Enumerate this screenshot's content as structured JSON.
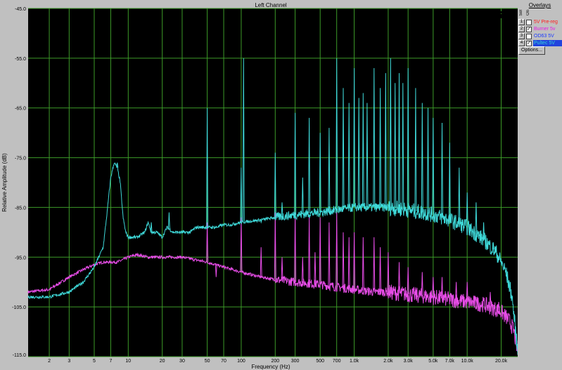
{
  "chart_data": {
    "type": "line",
    "title": "Left Channel",
    "xlabel": "Frequency (Hz)",
    "ylabel": "Relative Amplitude (dB)",
    "xscale": "log",
    "xlim": [
      1.3,
      28000
    ],
    "ylim": [
      -115,
      -45
    ],
    "grid": true,
    "x_ticks": [
      {
        "value": 2,
        "label": "2"
      },
      {
        "value": 3,
        "label": "3"
      },
      {
        "value": 5,
        "label": "5"
      },
      {
        "value": 7,
        "label": "7"
      },
      {
        "value": 10,
        "label": "10"
      },
      {
        "value": 20,
        "label": "20"
      },
      {
        "value": 30,
        "label": "30"
      },
      {
        "value": 50,
        "label": "50"
      },
      {
        "value": 70,
        "label": "70"
      },
      {
        "value": 100,
        "label": "100"
      },
      {
        "value": 200,
        "label": "200"
      },
      {
        "value": 300,
        "label": "300"
      },
      {
        "value": 500,
        "label": "500"
      },
      {
        "value": 700,
        "label": "700"
      },
      {
        "value": 1000,
        "label": "1.0k"
      },
      {
        "value": 2000,
        "label": "2.0k"
      },
      {
        "value": 3000,
        "label": "3.0k"
      },
      {
        "value": 5000,
        "label": "5.0k"
      },
      {
        "value": 7000,
        "label": "7.0k"
      },
      {
        "value": 10000,
        "label": "10.0k"
      },
      {
        "value": 20000,
        "label": "20.0k"
      }
    ],
    "y_ticks": [
      -45,
      -55,
      -65,
      -75,
      -85,
      -95,
      -105,
      -115
    ],
    "y_tick_labels": [
      "-45.0",
      "-55.0",
      "-65.0",
      "-75.0",
      "-85.0",
      "-95.0",
      "-105.0",
      "-115.0"
    ],
    "series": [
      {
        "name": "Pultec 5V",
        "color": "#3ed8d8",
        "x": [
          1.3,
          2,
          3,
          4,
          5,
          6,
          6.5,
          7,
          7.5,
          8,
          8.5,
          9,
          9.5,
          10,
          12,
          14,
          15,
          16,
          18,
          20,
          22,
          25,
          27,
          30,
          35,
          40,
          50,
          60,
          70,
          80,
          100,
          150,
          200,
          300,
          500,
          700,
          1000,
          1500,
          2000,
          3000,
          4000,
          5000,
          7000,
          10000,
          14000,
          18000,
          20000,
          22000,
          25000,
          28000
        ],
        "y": [
          -103,
          -103,
          -102,
          -100,
          -97,
          -93,
          -86,
          -79,
          -76,
          -77,
          -80,
          -87,
          -90,
          -91,
          -91,
          -90,
          -88,
          -90,
          -90,
          -91,
          -89,
          -90,
          -90,
          -90,
          -90,
          -89,
          -89,
          -89,
          -88.5,
          -88.5,
          -88,
          -87.5,
          -87,
          -86.5,
          -86,
          -85.5,
          -85,
          -85,
          -85,
          -85.5,
          -86,
          -86.5,
          -87.5,
          -89,
          -91.5,
          -94,
          -96,
          -98,
          -103,
          -114
        ],
        "peaks": [
          {
            "x": 8,
            "y": -76
          },
          {
            "x": 16,
            "y": -88
          },
          {
            "x": 23,
            "y": -86
          },
          {
            "x": 50,
            "y": -65
          },
          {
            "x": 100,
            "y": -77
          },
          {
            "x": 105,
            "y": -55
          },
          {
            "x": 150,
            "y": -88
          },
          {
            "x": 200,
            "y": -74
          },
          {
            "x": 230,
            "y": -84
          },
          {
            "x": 300,
            "y": -66
          },
          {
            "x": 350,
            "y": -79
          },
          {
            "x": 400,
            "y": -67
          },
          {
            "x": 500,
            "y": -70
          },
          {
            "x": 600,
            "y": -69
          },
          {
            "x": 700,
            "y": -55
          },
          {
            "x": 800,
            "y": -61
          },
          {
            "x": 900,
            "y": -64
          },
          {
            "x": 1000,
            "y": -57
          },
          {
            "x": 1100,
            "y": -63
          },
          {
            "x": 1200,
            "y": -62
          },
          {
            "x": 1300,
            "y": -64
          },
          {
            "x": 1500,
            "y": -57
          },
          {
            "x": 1700,
            "y": -61
          },
          {
            "x": 1900,
            "y": -58
          },
          {
            "x": 2100,
            "y": -55
          },
          {
            "x": 2300,
            "y": -60
          },
          {
            "x": 2500,
            "y": -58
          },
          {
            "x": 2700,
            "y": -60
          },
          {
            "x": 3000,
            "y": -57
          },
          {
            "x": 3500,
            "y": -61
          },
          {
            "x": 4000,
            "y": -64
          },
          {
            "x": 4500,
            "y": -65
          },
          {
            "x": 5000,
            "y": -67
          },
          {
            "x": 6000,
            "y": -68
          },
          {
            "x": 7000,
            "y": -72
          },
          {
            "x": 8500,
            "y": -77
          },
          {
            "x": 10000,
            "y": -82
          },
          {
            "x": 12000,
            "y": -84
          },
          {
            "x": 14000,
            "y": -88
          },
          {
            "x": 17000,
            "y": -92
          }
        ]
      },
      {
        "name": "Burner 5v",
        "color": "#e64ce6",
        "x": [
          1.3,
          2,
          3,
          4,
          5,
          6,
          7,
          8,
          9,
          10,
          12,
          15,
          20,
          30,
          50,
          70,
          100,
          150,
          200,
          300,
          500,
          700,
          1000,
          1500,
          2000,
          3000,
          5000,
          7000,
          10000,
          14000,
          18000,
          20000,
          22000,
          24000,
          26000,
          28000
        ],
        "y": [
          -102,
          -101.5,
          -99,
          -97.5,
          -96.5,
          -96,
          -96,
          -96,
          -95.5,
          -95,
          -94.5,
          -95,
          -95,
          -95,
          -96,
          -97,
          -98,
          -99,
          -99.5,
          -100,
          -100.5,
          -101,
          -101.5,
          -102,
          -102,
          -102.5,
          -103,
          -103.5,
          -104,
          -104.5,
          -105.5,
          -106,
          -107,
          -108,
          -110,
          -114
        ],
        "peaks": [
          {
            "x": 50,
            "y": -88
          },
          {
            "x": 60,
            "y": -99
          },
          {
            "x": 100,
            "y": -87
          },
          {
            "x": 150,
            "y": -93
          },
          {
            "x": 200,
            "y": -86
          },
          {
            "x": 230,
            "y": -95
          },
          {
            "x": 300,
            "y": -86
          },
          {
            "x": 350,
            "y": -95
          },
          {
            "x": 400,
            "y": -87
          },
          {
            "x": 450,
            "y": -94
          },
          {
            "x": 500,
            "y": -87
          },
          {
            "x": 600,
            "y": -88
          },
          {
            "x": 700,
            "y": -86
          },
          {
            "x": 800,
            "y": -90
          },
          {
            "x": 900,
            "y": -91
          },
          {
            "x": 1000,
            "y": -90
          },
          {
            "x": 1200,
            "y": -91
          },
          {
            "x": 1500,
            "y": -91
          },
          {
            "x": 1700,
            "y": -93
          },
          {
            "x": 2000,
            "y": -94
          },
          {
            "x": 2500,
            "y": -96
          },
          {
            "x": 3000,
            "y": -97
          },
          {
            "x": 4000,
            "y": -98
          },
          {
            "x": 5000,
            "y": -99
          },
          {
            "x": 6000,
            "y": -99
          },
          {
            "x": 8000,
            "y": -100
          },
          {
            "x": 10000,
            "y": -100
          },
          {
            "x": 12000,
            "y": -103
          },
          {
            "x": 16000,
            "y": -102
          },
          {
            "x": 19000,
            "y": -104
          }
        ]
      }
    ]
  },
  "overlays": {
    "title": "Overlays",
    "col_label_on": "On",
    "col_label_sel": "Sel",
    "options_label": "Options...",
    "items": [
      {
        "num": "1",
        "name": "5V Pre-reg",
        "checked": false,
        "check_mark": "",
        "color": "#ff1a1a",
        "bg": ""
      },
      {
        "num": "2",
        "name": "Burner 5v",
        "checked": true,
        "check_mark": "✓",
        "color": "#e61ae6",
        "bg": ""
      },
      {
        "num": "3",
        "name": "OD63 5V",
        "checked": false,
        "check_mark": "",
        "color": "#1a3aff",
        "bg": ""
      },
      {
        "num": "4",
        "name": "Pultec 5V",
        "checked": true,
        "check_mark": "✓",
        "color": "#34d6d6",
        "bg": "#2244dd"
      }
    ]
  },
  "colors": {
    "plot_bg": "#000000",
    "grid": "#3c9a28",
    "panel": "#c0c0c0"
  }
}
